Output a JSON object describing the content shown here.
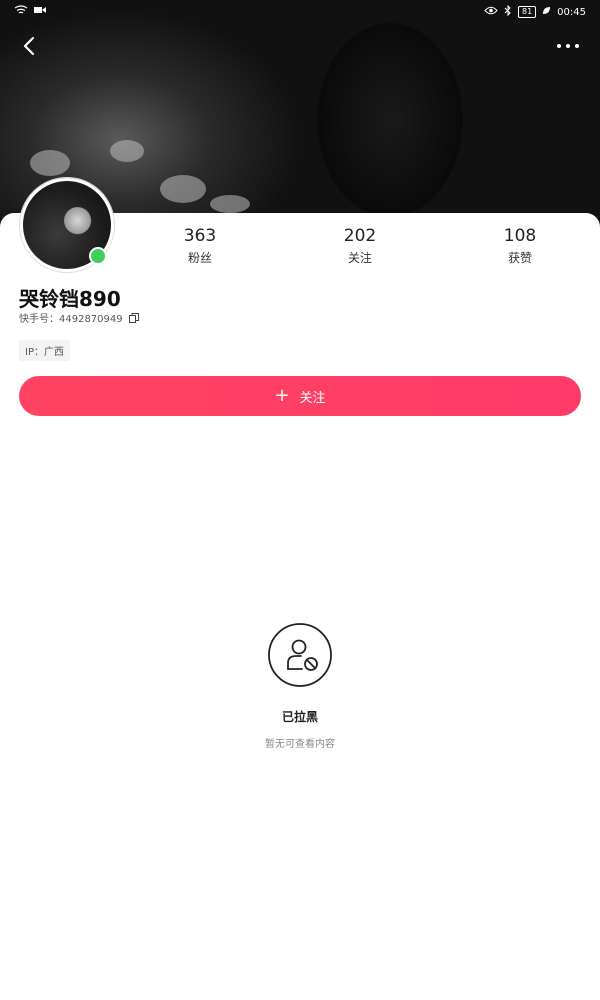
{
  "statusbar": {
    "time": "00:45",
    "battery": "81"
  },
  "profile": {
    "nickname": "哭铃铛890",
    "uid_label": "快手号：",
    "uid": "4492870949",
    "ip": "IP：广西"
  },
  "stats": [
    {
      "value": "363",
      "label": "粉丝"
    },
    {
      "value": "202",
      "label": "关注"
    },
    {
      "value": "108",
      "label": "获赞"
    }
  ],
  "follow_button": {
    "plus": "+",
    "label": "关注"
  },
  "empty_state": {
    "title": "已拉黑",
    "subtitle": "暂无可查看内容"
  },
  "colors": {
    "accent": "#ff3d65",
    "online": "#3fcf5c"
  }
}
